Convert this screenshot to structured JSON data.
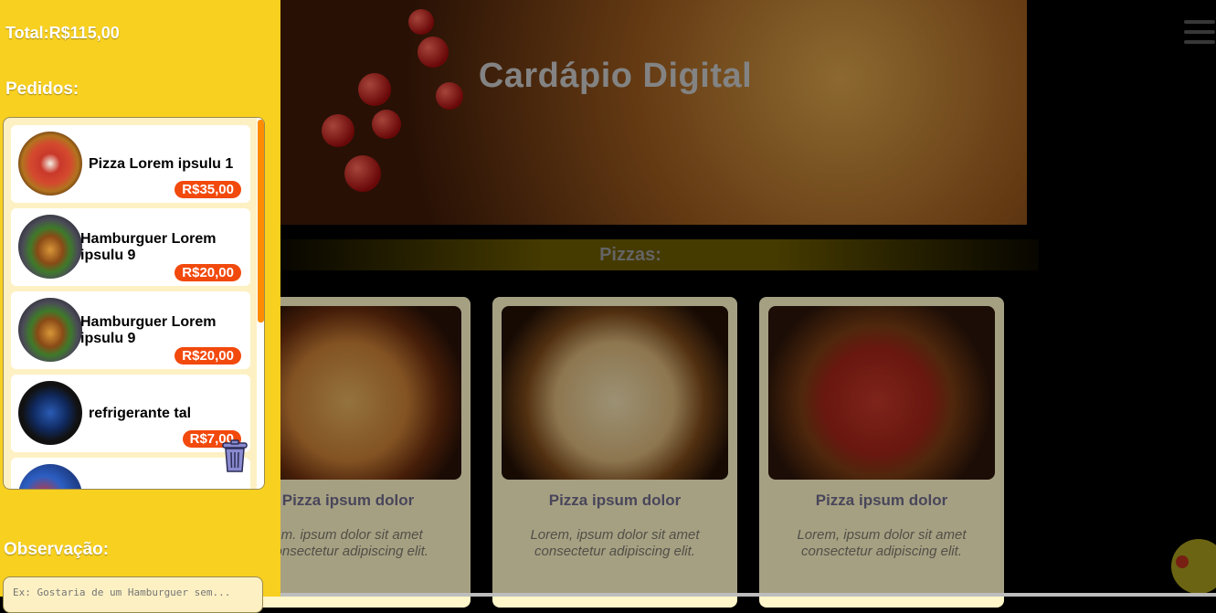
{
  "hero": {
    "title": "Cardápio Digital"
  },
  "section": {
    "title": "Pizzas:"
  },
  "menu_cards": [
    {
      "title": "Pizza ipsum dolor",
      "desc": "em. ipsum dolor sit amet consectetur adipiscing elit."
    },
    {
      "title": "Pizza ipsum dolor",
      "desc": "Lorem, ipsum dolor sit amet consectetur adipiscing elit."
    },
    {
      "title": "Pizza ipsum dolor",
      "desc": "Lorem, ipsum dolor sit amet consectetur adipiscing elit."
    }
  ],
  "sidebar": {
    "total": "Total:R$115,00",
    "orders_label": "Pedidos:",
    "observation_label": "Observação:",
    "observation_placeholder": "Ex: Gostaria de um Hamburguer sem...",
    "orders": [
      {
        "name": "Pizza Lorem ipsulu 1",
        "price": "R$35,00",
        "icon": "pizza-image"
      },
      {
        "name": "Hamburguer Lorem ipsulu 9",
        "price": "R$20,00",
        "icon": "burger-image"
      },
      {
        "name": "Hamburguer Lorem ipsulu 9",
        "price": "R$20,00",
        "icon": "burger-image"
      },
      {
        "name": "refrigerante tal",
        "price": "R$7,00",
        "icon": "pepsi-can-image"
      }
    ]
  },
  "colors": {
    "sidebar_bg": "#f8d020",
    "price_badge": "#f2490c",
    "scroll_thumb": "#ff8c00",
    "card_bg": "#fff6c9"
  }
}
